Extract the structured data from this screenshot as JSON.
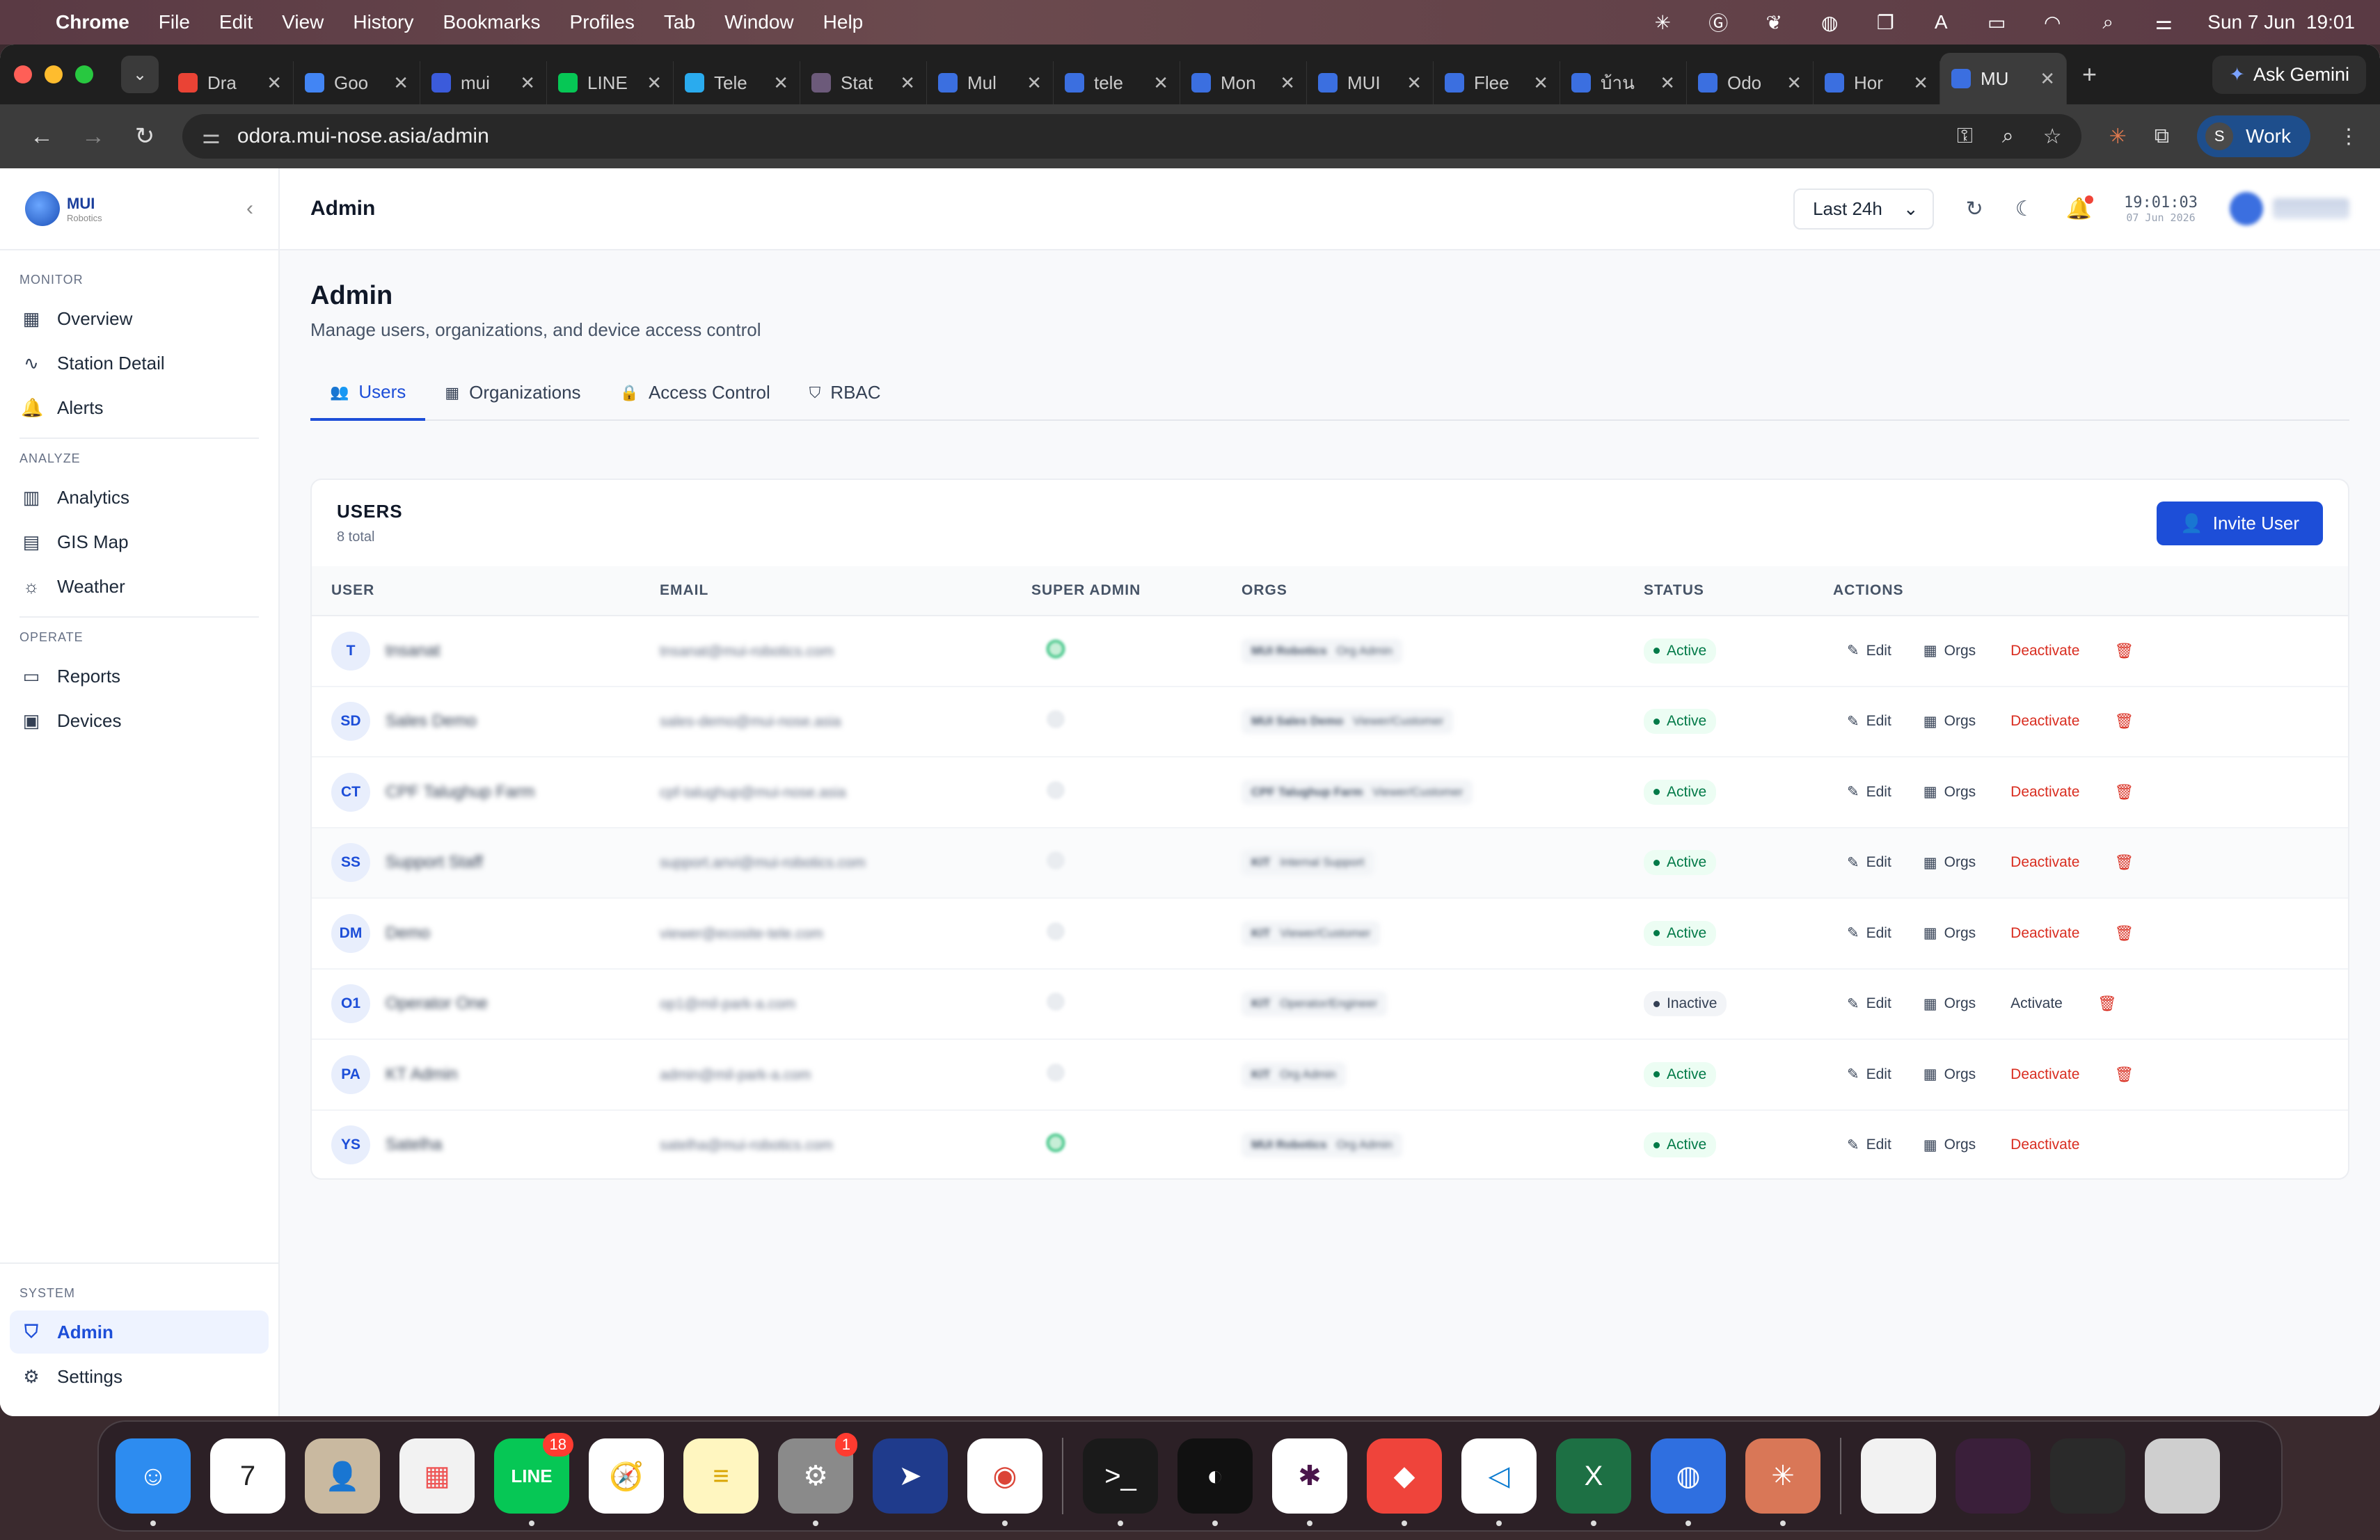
{
  "menubar": {
    "app": "Chrome",
    "items": [
      "File",
      "Edit",
      "View",
      "History",
      "Bookmarks",
      "Profiles",
      "Tab",
      "Window",
      "Help"
    ],
    "clock": "Sun 7 Jun  19:01",
    "icons": [
      "perplexity-icon",
      "grammarly-icon",
      "figma-icon",
      "line-icon",
      "window-icon",
      "input-a-icon",
      "battery-icon",
      "wifi-icon",
      "spotlight-icon",
      "control-center-icon"
    ]
  },
  "browser": {
    "tabs": [
      {
        "title": "Dra",
        "icon": "gmail-icon",
        "color": "#ea4335"
      },
      {
        "title": "Goo",
        "icon": "google-docs-icon",
        "color": "#4285f4"
      },
      {
        "title": "mui",
        "icon": "number-7-icon",
        "color": "#3b5bdb"
      },
      {
        "title": "LINE",
        "icon": "line-icon",
        "color": "#06c755"
      },
      {
        "title": "Tele",
        "icon": "telegram-icon",
        "color": "#2aabee"
      },
      {
        "title": "Stat",
        "icon": "status-icon",
        "color": "#6c5a7a"
      },
      {
        "title": "Mul",
        "icon": "mui-icon",
        "color": "#3b6fe0"
      },
      {
        "title": "tele",
        "icon": "mui-icon",
        "color": "#3b6fe0"
      },
      {
        "title": "Mon",
        "icon": "mui-icon",
        "color": "#3b6fe0"
      },
      {
        "title": "MUI",
        "icon": "mui-icon",
        "color": "#3b6fe0"
      },
      {
        "title": "Flee",
        "icon": "mui-icon",
        "color": "#3b6fe0"
      },
      {
        "title": "บ้าน",
        "icon": "mui-icon",
        "color": "#3b6fe0"
      },
      {
        "title": "Odo",
        "icon": "mui-icon",
        "color": "#3b6fe0"
      },
      {
        "title": "Hor",
        "icon": "mui-icon",
        "color": "#3b6fe0"
      },
      {
        "title": "MU",
        "icon": "mui-icon",
        "color": "#3b6fe0",
        "active": true
      }
    ],
    "gemini_label": "Ask Gemini",
    "url": "odora.mui-nose.asia/admin",
    "profile_initial": "S",
    "profile_label": "Work"
  },
  "sidebar": {
    "brand_title": "MUI",
    "brand_sub": "Robotics",
    "sections": [
      {
        "label": "MONITOR",
        "items": [
          {
            "label": "Overview",
            "icon": "grid-icon",
            "glyph": "▦"
          },
          {
            "label": "Station Detail",
            "icon": "activity-icon",
            "glyph": "∿"
          },
          {
            "label": "Alerts",
            "icon": "bell-icon",
            "glyph": "🔔"
          }
        ]
      },
      {
        "label": "ANALYZE",
        "items": [
          {
            "label": "Analytics",
            "icon": "bar-chart-icon",
            "glyph": "▥"
          },
          {
            "label": "GIS Map",
            "icon": "map-icon",
            "glyph": "▤"
          },
          {
            "label": "Weather",
            "icon": "weather-icon",
            "glyph": "☼"
          }
        ]
      },
      {
        "label": "OPERATE",
        "items": [
          {
            "label": "Reports",
            "icon": "file-icon",
            "glyph": "▭"
          },
          {
            "label": "Devices",
            "icon": "chip-icon",
            "glyph": "▣"
          }
        ]
      }
    ],
    "system_label": "SYSTEM",
    "system_items": [
      {
        "label": "Admin",
        "icon": "shield-icon",
        "glyph": "⛉",
        "active": true
      },
      {
        "label": "Settings",
        "icon": "gear-icon",
        "glyph": "⚙"
      }
    ]
  },
  "topbar": {
    "title": "Admin",
    "range": "Last 24h",
    "time": "19:01:03",
    "date": "07 Jun 2026"
  },
  "page": {
    "title": "Admin",
    "subtitle": "Manage users, organizations, and device access control",
    "tabs": [
      {
        "label": "Users",
        "icon": "users-icon",
        "glyph": "👥",
        "active": true
      },
      {
        "label": "Organizations",
        "icon": "building-icon",
        "glyph": "▦"
      },
      {
        "label": "Access Control",
        "icon": "lock-icon",
        "glyph": "🔒"
      },
      {
        "label": "RBAC",
        "icon": "shield-icon",
        "glyph": "⛉"
      }
    ]
  },
  "users_card": {
    "heading": "USERS",
    "count": "8 total",
    "invite_label": "Invite User",
    "columns": [
      "USER",
      "EMAIL",
      "SUPER ADMIN",
      "ORGS",
      "STATUS",
      "ACTIONS"
    ],
    "action_edit": "Edit",
    "action_orgs": "Orgs",
    "rows": [
      {
        "initials": "T",
        "name": "tnsanat",
        "email": "tnsanat@mui-robotics.com",
        "super": true,
        "org": "MUI Robotics",
        "role": "Org Admin",
        "status": "Active",
        "toggle": "Deactivate",
        "deletable": true
      },
      {
        "initials": "SD",
        "name": "Sales Demo",
        "email": "sales-demo@mui-nose.asia",
        "super": false,
        "org": "MUI Sales Demo",
        "role": "Viewer/Customer",
        "status": "Active",
        "toggle": "Deactivate",
        "deletable": true
      },
      {
        "initials": "CT",
        "name": "CPF Talughup Farm",
        "email": "cpf-talughup@mui-nose.asia",
        "super": false,
        "org": "CPF Talughup Farm",
        "role": "Viewer/Customer",
        "status": "Active",
        "toggle": "Deactivate",
        "deletable": true
      },
      {
        "initials": "SS",
        "name": "Support Staff",
        "email": "support.anvi@mui-robotics.com",
        "super": false,
        "org": "KIT",
        "role": "Internal Support",
        "status": "Active",
        "toggle": "Deactivate",
        "deletable": true
      },
      {
        "initials": "DM",
        "name": "Demo",
        "email": "viewer@ecosite-tele.com",
        "super": false,
        "org": "KIT",
        "role": "Viewer/Customer",
        "status": "Active",
        "toggle": "Deactivate",
        "deletable": true
      },
      {
        "initials": "O1",
        "name": "Operator One",
        "email": "op1@mil-park-a.com",
        "super": false,
        "org": "KIT",
        "role": "Operator/Engineer",
        "status": "Inactive",
        "toggle": "Activate",
        "deletable": true
      },
      {
        "initials": "PA",
        "name": "KT Admin",
        "email": "admin@mil-park-a.com",
        "super": false,
        "org": "KIT",
        "role": "Org Admin",
        "status": "Active",
        "toggle": "Deactivate",
        "deletable": true
      },
      {
        "initials": "YS",
        "name": "Satelha",
        "email": "satelha@mui-robotics.com",
        "super": true,
        "org": "MUI Robotics",
        "role": "Org Admin",
        "status": "Active",
        "toggle": "Deactivate",
        "deletable": false
      }
    ]
  },
  "dock": {
    "apps": [
      {
        "name": "finder-icon",
        "bg": "#2d8cf0",
        "glyph": "☺",
        "run": true
      },
      {
        "name": "calendar-icon",
        "bg": "#ffffff",
        "glyph": "7",
        "fg": "#222",
        "run": false
      },
      {
        "name": "contacts-icon",
        "bg": "#c9b9a0",
        "glyph": "👤",
        "run": false
      },
      {
        "name": "launchpad-icon",
        "bg": "#f2f2f2",
        "glyph": "▦",
        "fg": "#e55",
        "run": false
      },
      {
        "name": "line-app-icon",
        "bg": "#06c755",
        "glyph": "LINE",
        "badge": "18",
        "run": true
      },
      {
        "name": "safari-icon",
        "bg": "#ffffff",
        "glyph": "🧭",
        "run": false
      },
      {
        "name": "notes-icon",
        "bg": "#fff6c0",
        "glyph": "≡",
        "fg": "#d9a400",
        "run": false
      },
      {
        "name": "system-settings-icon",
        "bg": "#8a8a8a",
        "glyph": "⚙",
        "badge": "1",
        "run": true
      },
      {
        "name": "direct-icon",
        "bg": "#1f3b8c",
        "glyph": "➤",
        "run": false
      },
      {
        "name": "chrome-icon",
        "bg": "#ffffff",
        "glyph": "◉",
        "fg": "#db4437",
        "run": true
      },
      {
        "name": "terminal-icon",
        "bg": "#1a1a1a",
        "glyph": ">_",
        "run": true
      },
      {
        "name": "linear-icon",
        "bg": "#111111",
        "glyph": "◐",
        "run": true
      },
      {
        "name": "slack-icon",
        "bg": "#ffffff",
        "glyph": "✱",
        "fg": "#4a154b",
        "run": true
      },
      {
        "name": "anydesk-icon",
        "bg": "#ef443b",
        "glyph": "◆",
        "run": true
      },
      {
        "name": "vscode-icon",
        "bg": "#ffffff",
        "glyph": "◁",
        "fg": "#0a7bd0",
        "run": true
      },
      {
        "name": "excel-icon",
        "bg": "#1d7044",
        "glyph": "X",
        "run": true
      },
      {
        "name": "preview-icon",
        "bg": "#2f6fe0",
        "glyph": "◍",
        "run": true
      },
      {
        "name": "claude-icon",
        "bg": "#d97757",
        "glyph": "✳",
        "run": true
      }
    ],
    "recents": [
      {
        "name": "document-thumbnail-icon",
        "bg": "#f2f2f2"
      },
      {
        "name": "slack-window-thumbnail-icon",
        "bg": "#3a1f3a"
      },
      {
        "name": "claude-window-thumbnail-icon",
        "bg": "#2a2a2a"
      },
      {
        "name": "trash-icon",
        "bg": "#cfcfcf"
      }
    ]
  }
}
